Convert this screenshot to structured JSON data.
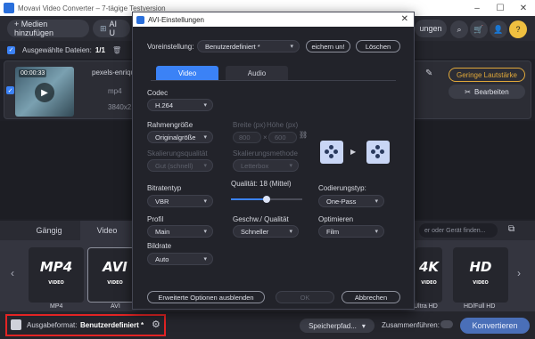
{
  "window": {
    "title": "Movavi Video Converter – 7-tägige Testversion"
  },
  "toolbar": {
    "add_media": "+ Medien hinzufügen",
    "ai_label": "AI U",
    "right_label": "ungen"
  },
  "subbar": {
    "selected_label": "Ausgewählte Dateien:",
    "selected_count": "1/1"
  },
  "file": {
    "duration": "00:00:33",
    "name": "pexels-enriqu",
    "format": "mp4",
    "resolution": "3840x21",
    "volume_btn": "Geringe Lautstärke",
    "edit_btn": "Bearbeiten"
  },
  "formats": {
    "tabs": [
      "Gängig",
      "Video"
    ],
    "search_placeholder": "er oder Gerät finden...",
    "cards": [
      {
        "logo": "MP4",
        "sub": "VIDEO",
        "label": "MP4"
      },
      {
        "logo": "AVI",
        "sub": "VIDEO",
        "label": "AVI"
      },
      {
        "logo": "4K",
        "sub": "VIDEO",
        "label": "Ultra HD"
      },
      {
        "logo": "HD",
        "sub": "VIDEO",
        "label": "HD/Full HD"
      }
    ]
  },
  "bottom": {
    "output_label": "Ausgabeformat:",
    "output_value": "Benutzerdefiniert *",
    "save_path": "Speicherpfad...",
    "merge": "Zusammenführen:",
    "convert": "Konvertieren"
  },
  "dialog": {
    "title": "AVI-Einstellungen",
    "preset_label": "Voreinstellung:",
    "preset_value": "Benutzerdefiniert *",
    "save_btn": "eichern un!",
    "delete_btn": "Löschen",
    "tabs": [
      "Video",
      "Audio"
    ],
    "codec_label": "Codec",
    "codec_value": "H.264",
    "framesize_label": "Rahmengröße",
    "framesize_value": "Originalgröße",
    "width_label": "Breite (px)",
    "height_label": "Höhe (px)",
    "width_value": "800",
    "height_value": "600",
    "times": "×",
    "scaling_quality_label": "Skalierungsqualität",
    "scaling_quality_value": "Gut (schnell)",
    "scaling_method_label": "Skalierungsmethode",
    "scaling_method_value": "Letterbox",
    "bitrate_type_label": "Bitratentyp",
    "bitrate_type_value": "VBR",
    "quality_label": "Qualität: 18 (Mittel)",
    "quality_fraction": 0.5,
    "encoding_label": "Codierungstyp:",
    "encoding_value": "One-Pass",
    "profile_label": "Profil",
    "profile_value": "Main",
    "speed_label": "Geschw./ Qualität",
    "speed_value": "Schneller",
    "optimize_label": "Optimieren",
    "optimize_value": "Film",
    "bitrate_label": "Bildrate",
    "bitrate_value": "Auto",
    "advanced_btn": "Erweiterte Optionen ausblenden",
    "ok_btn": "OK",
    "cancel_btn": "Abbrechen"
  },
  "colors": {
    "accent": "#3b82f6",
    "volume_btn_border": "#e0a83a",
    "highlight": "#e32424"
  }
}
